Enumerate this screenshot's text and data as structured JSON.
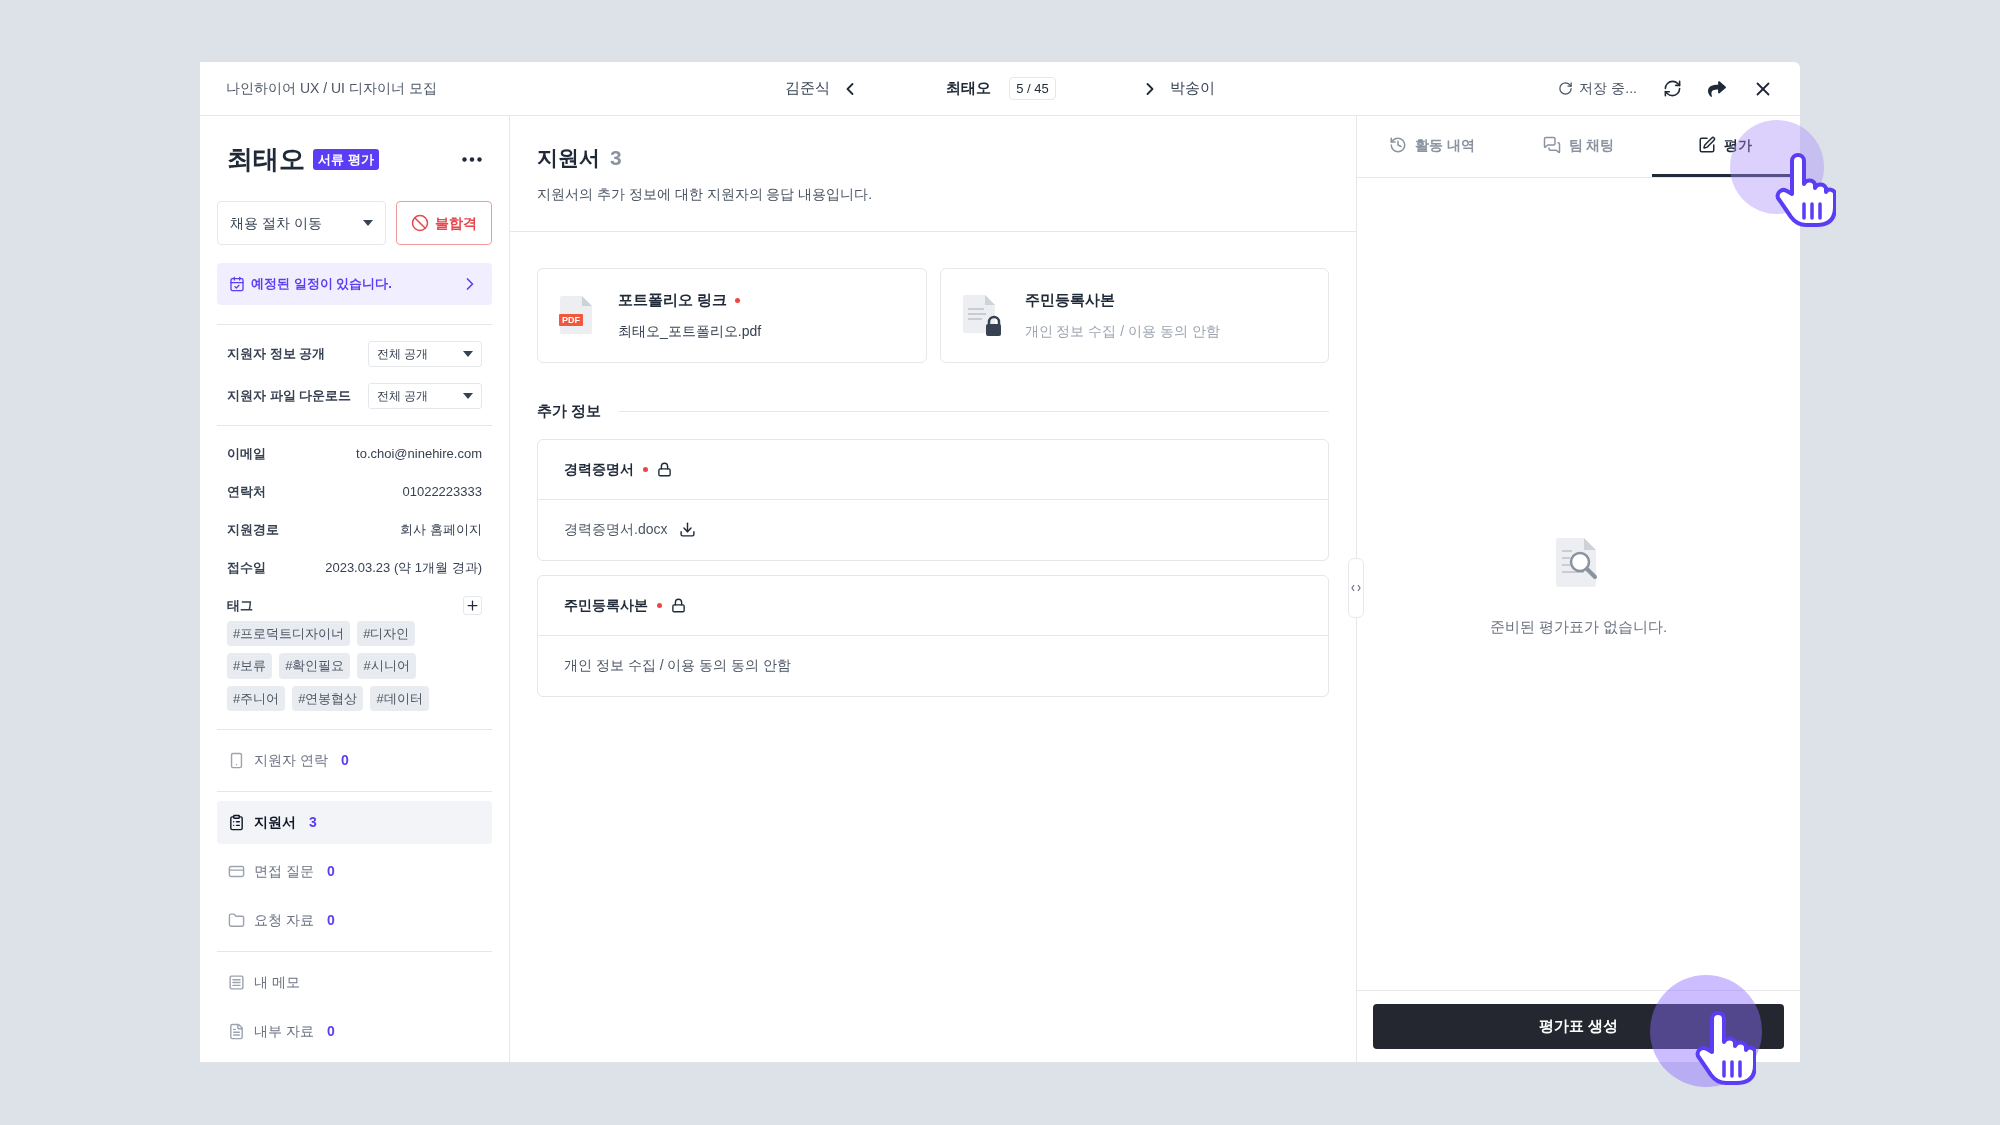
{
  "header": {
    "breadcrumb": "나인하이어 UX / UI 디자이너 모집",
    "prev_name": "김준식",
    "current_name": "최태오",
    "position": "5 / 45",
    "next_name": "박송이",
    "save_status": "저장 중..."
  },
  "candidate": {
    "name": "최태오",
    "stage_badge": "서류 평가"
  },
  "actions": {
    "stage_select": "채용 절차 이동",
    "reject_button": "불합격"
  },
  "schedule_notice": "예정된 일정이 있습니다.",
  "settings": [
    {
      "label": "지원자 정보 공개",
      "value": "전체 공개"
    },
    {
      "label": "지원자 파일 다운로드",
      "value": "전체 공개"
    }
  ],
  "info": [
    {
      "label": "이메일",
      "value": "to.choi@ninehire.com"
    },
    {
      "label": "연락처",
      "value": "01022223333"
    },
    {
      "label": "지원경로",
      "value": "회사 홈페이지"
    },
    {
      "label": "접수일",
      "value": "2023.03.23 (약 1개월 경과)"
    }
  ],
  "tags": {
    "label": "태그",
    "items": [
      "#프로덕트디자이너",
      "#디자인",
      "#보류",
      "#확인필요",
      "#시니어",
      "#주니어",
      "#연봉협상",
      "#데이터"
    ]
  },
  "nav_groups": [
    [
      {
        "label": "지원자 연락",
        "count": "0",
        "selected": false
      }
    ],
    [
      {
        "label": "지원서",
        "count": "3",
        "selected": true
      },
      {
        "label": "면접 질문",
        "count": "0",
        "selected": false
      },
      {
        "label": "요청 자료",
        "count": "0",
        "selected": false
      }
    ],
    [
      {
        "label": "내 메모",
        "selected": false
      },
      {
        "label": "내부 자료",
        "count": "0",
        "selected": false
      }
    ]
  ],
  "main": {
    "title": "지원서",
    "count": "3",
    "description": "지원서의 추가 정보에 대한 지원자의 응답 내용입니다.",
    "attachments": [
      {
        "kind": "pdf",
        "file_type": "PDF",
        "title": "포트폴리오 링크",
        "required": true,
        "subtitle": "최태오_포트폴리오.pdf"
      },
      {
        "kind": "locked",
        "title": "주민등록사본",
        "required": false,
        "subtitle": "개인 정보 수집 / 이용 동의 안함"
      }
    ],
    "section_title": "추가 정보",
    "fields": [
      {
        "kind": "file",
        "title": "경력증명서",
        "required": true,
        "locked": true,
        "value": "경력증명서.docx"
      },
      {
        "kind": "text",
        "title": "주민등록사본",
        "required": true,
        "locked": true,
        "value": "개인 정보 수집 / 이용 동의 동의 안함"
      }
    ]
  },
  "side_panel": {
    "tabs": [
      {
        "label": "활동 내역",
        "selected": false
      },
      {
        "label": "팀 채팅",
        "selected": false
      },
      {
        "label": "평가",
        "selected": true
      }
    ],
    "empty_message": "준비된 평가표가 없습니다.",
    "create_button": "평가표 생성"
  }
}
